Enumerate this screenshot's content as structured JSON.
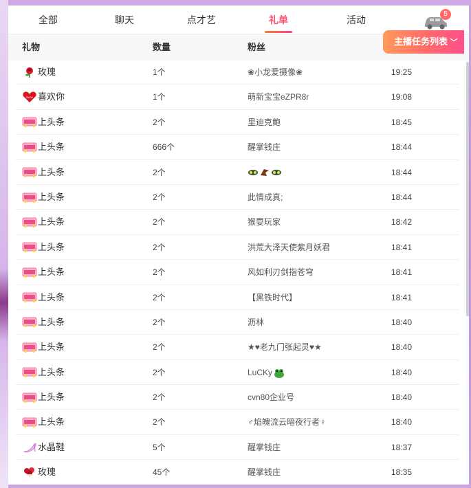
{
  "tabs": [
    {
      "label": "全部",
      "active": false
    },
    {
      "label": "聊天",
      "active": false
    },
    {
      "label": "点才艺",
      "active": false
    },
    {
      "label": "礼单",
      "active": true
    },
    {
      "label": "活动",
      "active": false
    }
  ],
  "car_badge": "5",
  "task_button": "主播任务列表",
  "columns": {
    "gift": "礼物",
    "qty": "数量",
    "fan": "粉丝"
  },
  "accent_color": "#ff4f6e",
  "rows": [
    {
      "icon": "rose-icon",
      "gift": "玫瑰",
      "qty": "1个",
      "fan": "❀小龙爱摄像❀",
      "time": "19:25"
    },
    {
      "icon": "heart-love-icon",
      "gift": "喜欢你",
      "qty": "1个",
      "fan": "萌新宝宝eZPR8r",
      "time": "19:08"
    },
    {
      "icon": "headline-icon",
      "gift": "上头条",
      "qty": "2个",
      "fan": "里迪克鲍",
      "time": "18:45"
    },
    {
      "icon": "headline-icon",
      "gift": "上头条",
      "qty": "666个",
      "fan": "醒掌钱庄",
      "time": "18:44"
    },
    {
      "icon": "headline-icon",
      "gift": "上头条",
      "qty": "2个",
      "fan": "",
      "fan_emoji": true,
      "time": "18:44"
    },
    {
      "icon": "headline-icon",
      "gift": "上头条",
      "qty": "2个",
      "fan": "此情成真;",
      "time": "18:44"
    },
    {
      "icon": "headline-icon",
      "gift": "上头条",
      "qty": "2个",
      "fan": "猴耍玩家",
      "time": "18:42"
    },
    {
      "icon": "headline-icon",
      "gift": "上头条",
      "qty": "2个",
      "fan": "洪荒大泽天使紫月妖君",
      "time": "18:41"
    },
    {
      "icon": "headline-icon",
      "gift": "上头条",
      "qty": "2个",
      "fan": "风如利刃剑指苍穹",
      "time": "18:41"
    },
    {
      "icon": "headline-icon",
      "gift": "上头条",
      "qty": "2个",
      "fan": "【黑铁时代】",
      "time": "18:41"
    },
    {
      "icon": "headline-icon",
      "gift": "上头条",
      "qty": "2个",
      "fan": "沥林",
      "time": "18:40"
    },
    {
      "icon": "headline-icon",
      "gift": "上头条",
      "qty": "2个",
      "fan": "★♥老九门张起灵♥★",
      "time": "18:40"
    },
    {
      "icon": "headline-icon",
      "gift": "上头条",
      "qty": "2个",
      "fan": "LuCKy",
      "fan_frog": true,
      "time": "18:40"
    },
    {
      "icon": "headline-icon",
      "gift": "上头条",
      "qty": "2个",
      "fan": "cvn80企业号",
      "time": "18:40"
    },
    {
      "icon": "headline-icon",
      "gift": "上头条",
      "qty": "2个",
      "fan": "♂焰魄流云暗夜行者♀",
      "time": "18:40"
    },
    {
      "icon": "crystal-shoe-icon",
      "gift": "水晶鞋",
      "qty": "5个",
      "fan": "醒掌钱庄",
      "time": "18:37"
    },
    {
      "icon": "rose-bouquet-icon",
      "gift": "玫瑰",
      "qty": "45个",
      "fan": "醒掌钱庄",
      "time": "18:35"
    }
  ]
}
